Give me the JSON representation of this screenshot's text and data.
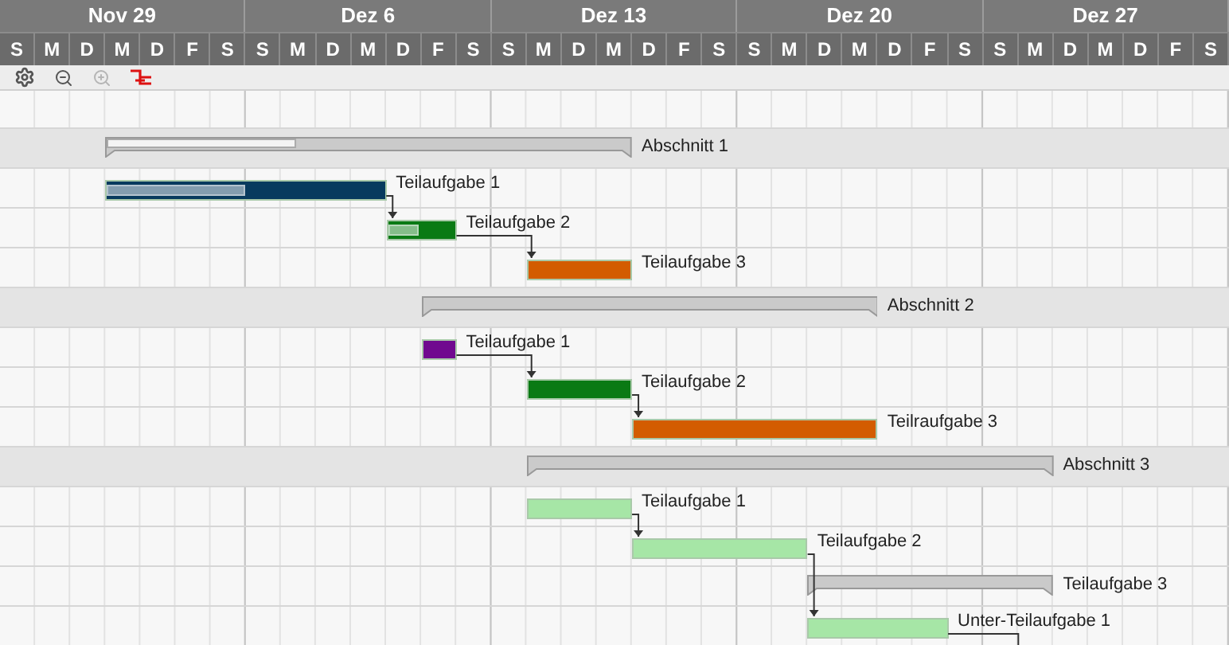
{
  "weeks": [
    {
      "label": "Nov 29",
      "days": [
        "S",
        "M",
        "D",
        "M",
        "D",
        "F",
        "S"
      ]
    },
    {
      "label": "Dez 6",
      "days": [
        "S",
        "M",
        "D",
        "M",
        "D",
        "F",
        "S"
      ]
    },
    {
      "label": "Dez 13",
      "days": [
        "S",
        "M",
        "D",
        "M",
        "D",
        "F",
        "S"
      ]
    },
    {
      "label": "Dez 20",
      "days": [
        "S",
        "M",
        "D",
        "M",
        "D",
        "F",
        "S"
      ]
    },
    {
      "label": "Dez 27",
      "days": [
        "S",
        "M",
        "D",
        "M",
        "D",
        "F",
        "S"
      ]
    }
  ],
  "toolbar": [
    {
      "kind": "settings",
      "disabled": false
    },
    {
      "kind": "zoom-out",
      "disabled": false
    },
    {
      "kind": "zoom-in",
      "disabled": true
    },
    {
      "kind": "critical-path",
      "disabled": false
    }
  ],
  "sections": [
    {
      "label": "Abschnitt 1",
      "level": 0.36,
      "tasks": [
        {
          "kind": "task",
          "label": "Teilaufgabe 1",
          "color": "#073a5e",
          "level": 0.5,
          "dependency": false
        },
        {
          "kind": "task",
          "label": "Teilaufgabe 2",
          "color": "#0a7a14",
          "level": 0.45,
          "dependency": true
        },
        {
          "kind": "task",
          "label": "Teilaufgabe 3",
          "color": "#d35c00",
          "dependency": true
        }
      ]
    },
    {
      "label": "Abschnitt 2",
      "tasks": [
        {
          "kind": "task",
          "label": "Teilaufgabe 1",
          "color": "#70098f",
          "dependency": false
        },
        {
          "kind": "task",
          "label": "Teilaufgabe 2",
          "color": "#0a7a14",
          "dependency": true
        },
        {
          "kind": "task",
          "label": "Teilraufgabe 3",
          "color": "#d35c00",
          "dependency": true
        }
      ]
    },
    {
      "label": "Abschnitt 3",
      "tasks": [
        {
          "kind": "task",
          "label": "Teilaufgabe 1",
          "color": "#a6e6a6",
          "dependency": false
        },
        {
          "kind": "task",
          "label": "Teilaufgabe 2",
          "color": "#a6e6a6",
          "dependency": true
        },
        {
          "kind": "summary",
          "label": "Teilaufgabe 3",
          "children": [
            {
              "kind": "task",
              "label": "Unter-Teilaufgabe 1",
              "color": "#a6e6a6",
              "dependency": true,
              "successor_below": true
            }
          ]
        }
      ]
    }
  ]
}
